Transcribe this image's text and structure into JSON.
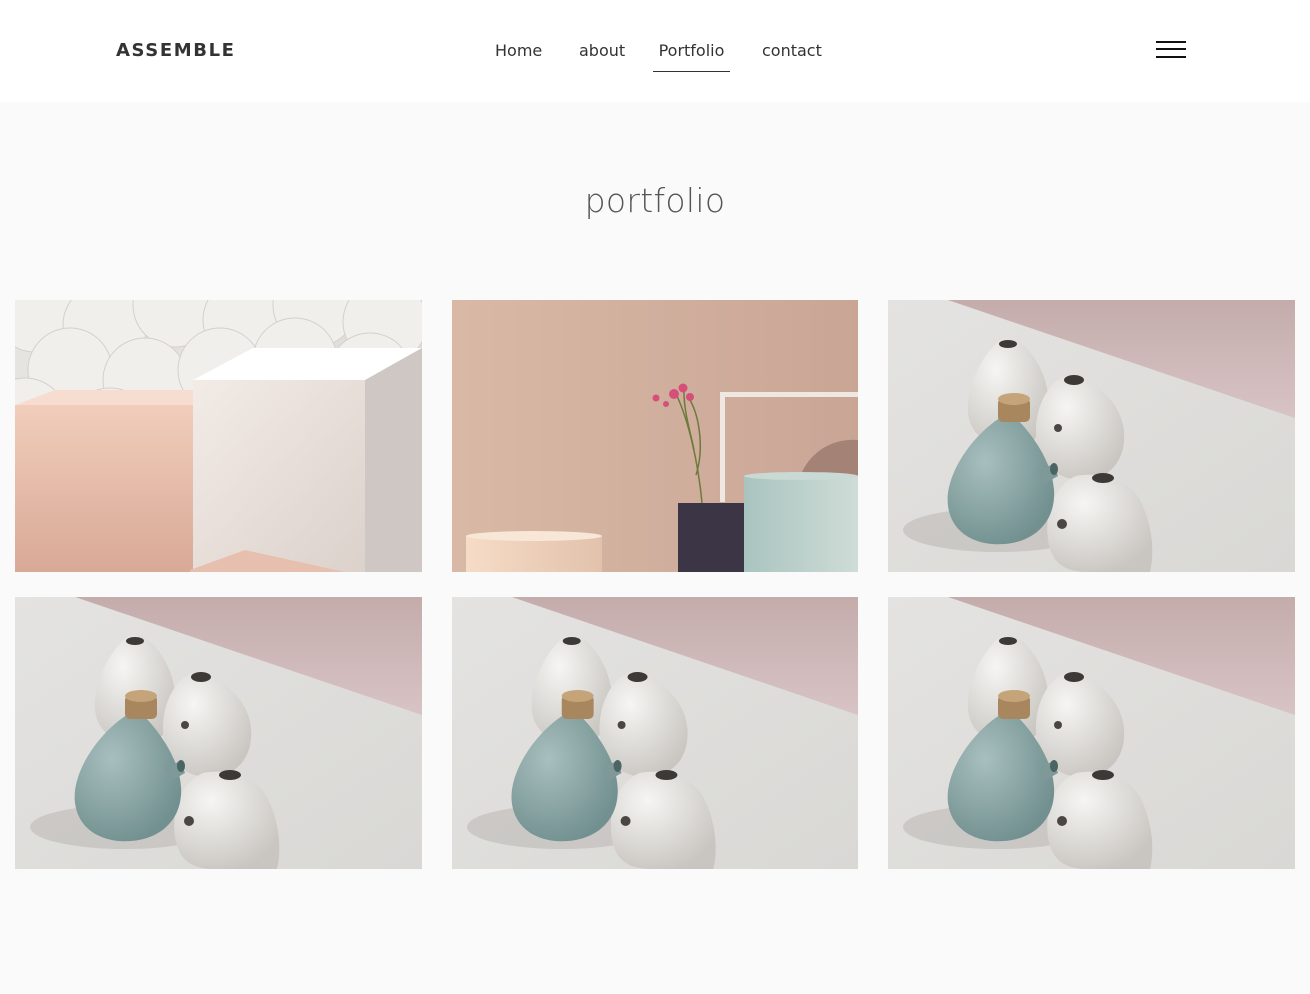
{
  "header": {
    "logo": "ASSEMBLE",
    "nav": [
      {
        "label": "Home",
        "active": false
      },
      {
        "label": "about",
        "active": false
      },
      {
        "label": "Portfolio",
        "active": true
      },
      {
        "label": "contact",
        "active": false
      }
    ],
    "menu_icon": "hamburger-menu-icon"
  },
  "main": {
    "title": "portfolio",
    "gallery": [
      {
        "subject": "pink and white geometric boxes"
      },
      {
        "subject": "pastel podiums with pink flowers"
      },
      {
        "subject": "ceramic vases"
      },
      {
        "subject": "ceramic vases"
      },
      {
        "subject": "ceramic vases"
      },
      {
        "subject": "ceramic vases"
      }
    ]
  },
  "colors": {
    "page_background": "#fafafa",
    "header_background": "#ffffff",
    "text": "#333333"
  }
}
